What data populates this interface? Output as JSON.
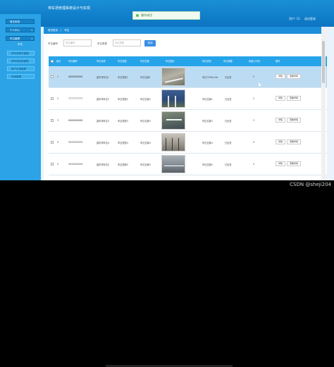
{
  "app": {
    "title": "停车场管理系统设计与实现"
  },
  "toast": {
    "text": "操作成功"
  },
  "user": {
    "role": "用户: 12",
    "logout": "退出登录"
  },
  "sidebar": {
    "items": [
      {
        "label": "首页系统"
      },
      {
        "label": "个人中心"
      },
      {
        "label": "车位管理"
      }
    ],
    "group": "车位",
    "subitems": [
      {
        "label": "停车场停车管理"
      },
      {
        "label": "停车场收费管理"
      },
      {
        "label": "用户出场管理"
      },
      {
        "label": "系统管理"
      }
    ]
  },
  "breadcrumb": {
    "home": "首页首页",
    "current": "车位"
  },
  "filter": {
    "label1": "车位编号",
    "placeholder1": "车位编号",
    "label2": "车位类型",
    "placeholder2": "车位类型",
    "search_label": "查询"
  },
  "table": {
    "headers": [
      "索引",
      "车位编号",
      "车位名称",
      "车位类型",
      "车位位置",
      "车位图片",
      "车位状态",
      "车位规格",
      "收费(/小时)",
      "操作"
    ],
    "rows": [
      {
        "index": "1",
        "code": "8888888888",
        "name": "露车场车位1",
        "type": "车位类型1",
        "loc": "车位位置1",
        "status": "车位7558c14d",
        "spec": "已出售",
        "price": "3",
        "img": "a"
      },
      {
        "index": "2",
        "code": "7777777777",
        "name": "露车场车位2",
        "type": "车位类型2",
        "loc": "车位位置2",
        "status": "车位位置2",
        "spec": "已出售",
        "price": "2",
        "img": "b"
      },
      {
        "index": "3",
        "code": "6666666666",
        "name": "露车场车位3",
        "type": "车位类型3",
        "loc": "车位位置3",
        "status": "车位位置3",
        "spec": "已出售",
        "price": "3",
        "img": "c"
      },
      {
        "index": "4",
        "code": "5555555555",
        "name": "露车场车位4",
        "type": "车位类型4",
        "loc": "车位位置4",
        "status": "车位位置4",
        "spec": "已出售",
        "price": "4",
        "img": "d"
      },
      {
        "index": "5",
        "code": "4444444444",
        "name": "露车场车位5",
        "type": "车位类型5",
        "loc": "车位位置5",
        "status": "车位位置5",
        "spec": "已出售",
        "price": "5",
        "img": "e"
      }
    ],
    "action_edit": "详情",
    "action_del": "查看详情"
  },
  "watermark": "CSDN @sheji204",
  "colors": {
    "header": "#1a8fd6",
    "sidebar": "#2ba3e6",
    "table_head": "#26a4ea",
    "row_highlight": "#bcdcf3"
  }
}
